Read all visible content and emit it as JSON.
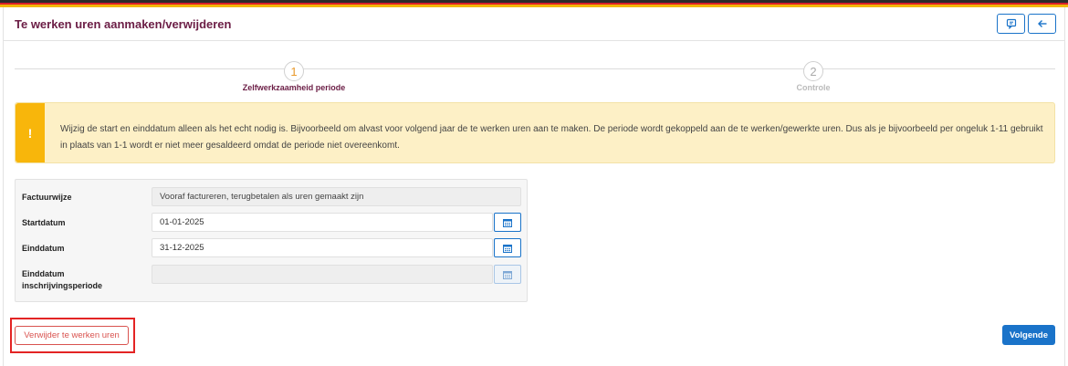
{
  "header": {
    "title": "Te werken uren aanmaken/verwijderen",
    "chat_icon": "chat-icon",
    "back_icon": "arrow-left-icon"
  },
  "stepper": {
    "steps": [
      {
        "number": "1",
        "label": "Zelfwerkzaamheid periode",
        "active": true
      },
      {
        "number": "2",
        "label": "Controle",
        "active": false
      }
    ]
  },
  "alert": {
    "icon": "!",
    "text": "Wijzig de start en einddatum alleen als het echt nodig is. Bijvoorbeeld om alvast voor volgend jaar de te werken uren aan te maken. De periode wordt gekoppeld aan de te werken/gewerkte uren. Dus als je bijvoorbeeld per ongeluk 1-11 gebruikt in plaats van 1-1 wordt er niet meer gesaldeerd omdat de periode niet overeenkomt."
  },
  "form": {
    "factuurwijze": {
      "label": "Factuurwijze",
      "value": "Vooraf factureren, terugbetalen als uren gemaakt zijn"
    },
    "startdatum": {
      "label": "Startdatum",
      "value": "01-01-2025"
    },
    "einddatum": {
      "label": "Einddatum",
      "value": "31-12-2025"
    },
    "einddatum_inschrijving": {
      "label": "Einddatum inschrijvingsperiode",
      "value": ""
    }
  },
  "actions": {
    "delete_label": "Verwijder te werken uren",
    "next_label": "Volgende"
  },
  "colors": {
    "accent": "#1a73c9",
    "title": "#6b1d45",
    "warning": "#f8b60b",
    "danger": "#d9534f",
    "highlight": "#e32424"
  }
}
